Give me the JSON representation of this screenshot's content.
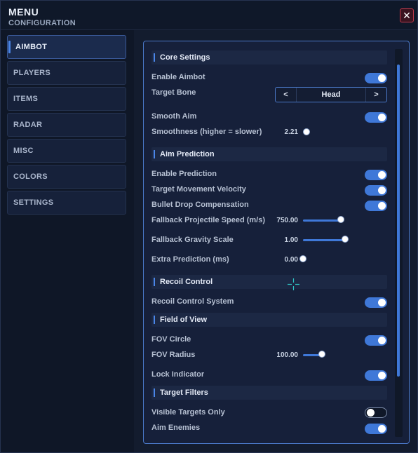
{
  "header": {
    "title": "MENU",
    "subtitle": "CONFIGURATION",
    "close_label": "✕"
  },
  "sidebar": {
    "items": [
      {
        "label": "AIMBOT",
        "active": true
      },
      {
        "label": "PLAYERS"
      },
      {
        "label": "ITEMS"
      },
      {
        "label": "RADAR"
      },
      {
        "label": "MISC"
      },
      {
        "label": "COLORS"
      },
      {
        "label": "SETTINGS"
      }
    ]
  },
  "colors": {
    "accent": "#3f78d8",
    "close_border": "#c0394a",
    "crosshair": "#2ec4c4"
  },
  "sections": {
    "core": "Core Settings",
    "prediction": "Aim Prediction",
    "recoil": "Recoil Control",
    "fov": "Field of View",
    "filters": "Target Filters"
  },
  "settings": {
    "enable_aimbot": {
      "label": "Enable Aimbot",
      "on": true
    },
    "target_bone": {
      "label": "Target Bone",
      "value": "Head",
      "prev": "<",
      "next": ">"
    },
    "smooth_aim": {
      "label": "Smooth Aim",
      "on": true
    },
    "smoothness": {
      "label": "Smoothness (higher = slower)",
      "value": "2.21",
      "fraction": 0.0
    },
    "enable_prediction": {
      "label": "Enable Prediction",
      "on": true
    },
    "target_velocity": {
      "label": "Target Movement Velocity",
      "on": true
    },
    "bullet_drop": {
      "label": "Bullet Drop Compensation",
      "on": true
    },
    "projectile_speed": {
      "label": "Fallback Projectile Speed (m/s)",
      "value": "750.00",
      "fraction": 0.9
    },
    "gravity_scale": {
      "label": "Fallback Gravity Scale",
      "value": "1.00",
      "fraction": 1.0
    },
    "extra_prediction": {
      "label": "Extra Prediction (ms)",
      "value": "0.00",
      "fraction": 0.0
    },
    "recoil_system": {
      "label": "Recoil Control System",
      "on": true
    },
    "fov_circle": {
      "label": "FOV Circle",
      "on": true
    },
    "fov_radius": {
      "label": "FOV Radius",
      "value": "100.00",
      "fraction": 0.45
    },
    "lock_indicator": {
      "label": "Lock Indicator",
      "on": true
    },
    "visible_only": {
      "label": "Visible Targets Only",
      "on": false
    },
    "aim_enemies": {
      "label": "Aim Enemies",
      "on": true
    }
  },
  "icons": {
    "close": "close-icon",
    "crosshair": "crosshair-icon"
  }
}
